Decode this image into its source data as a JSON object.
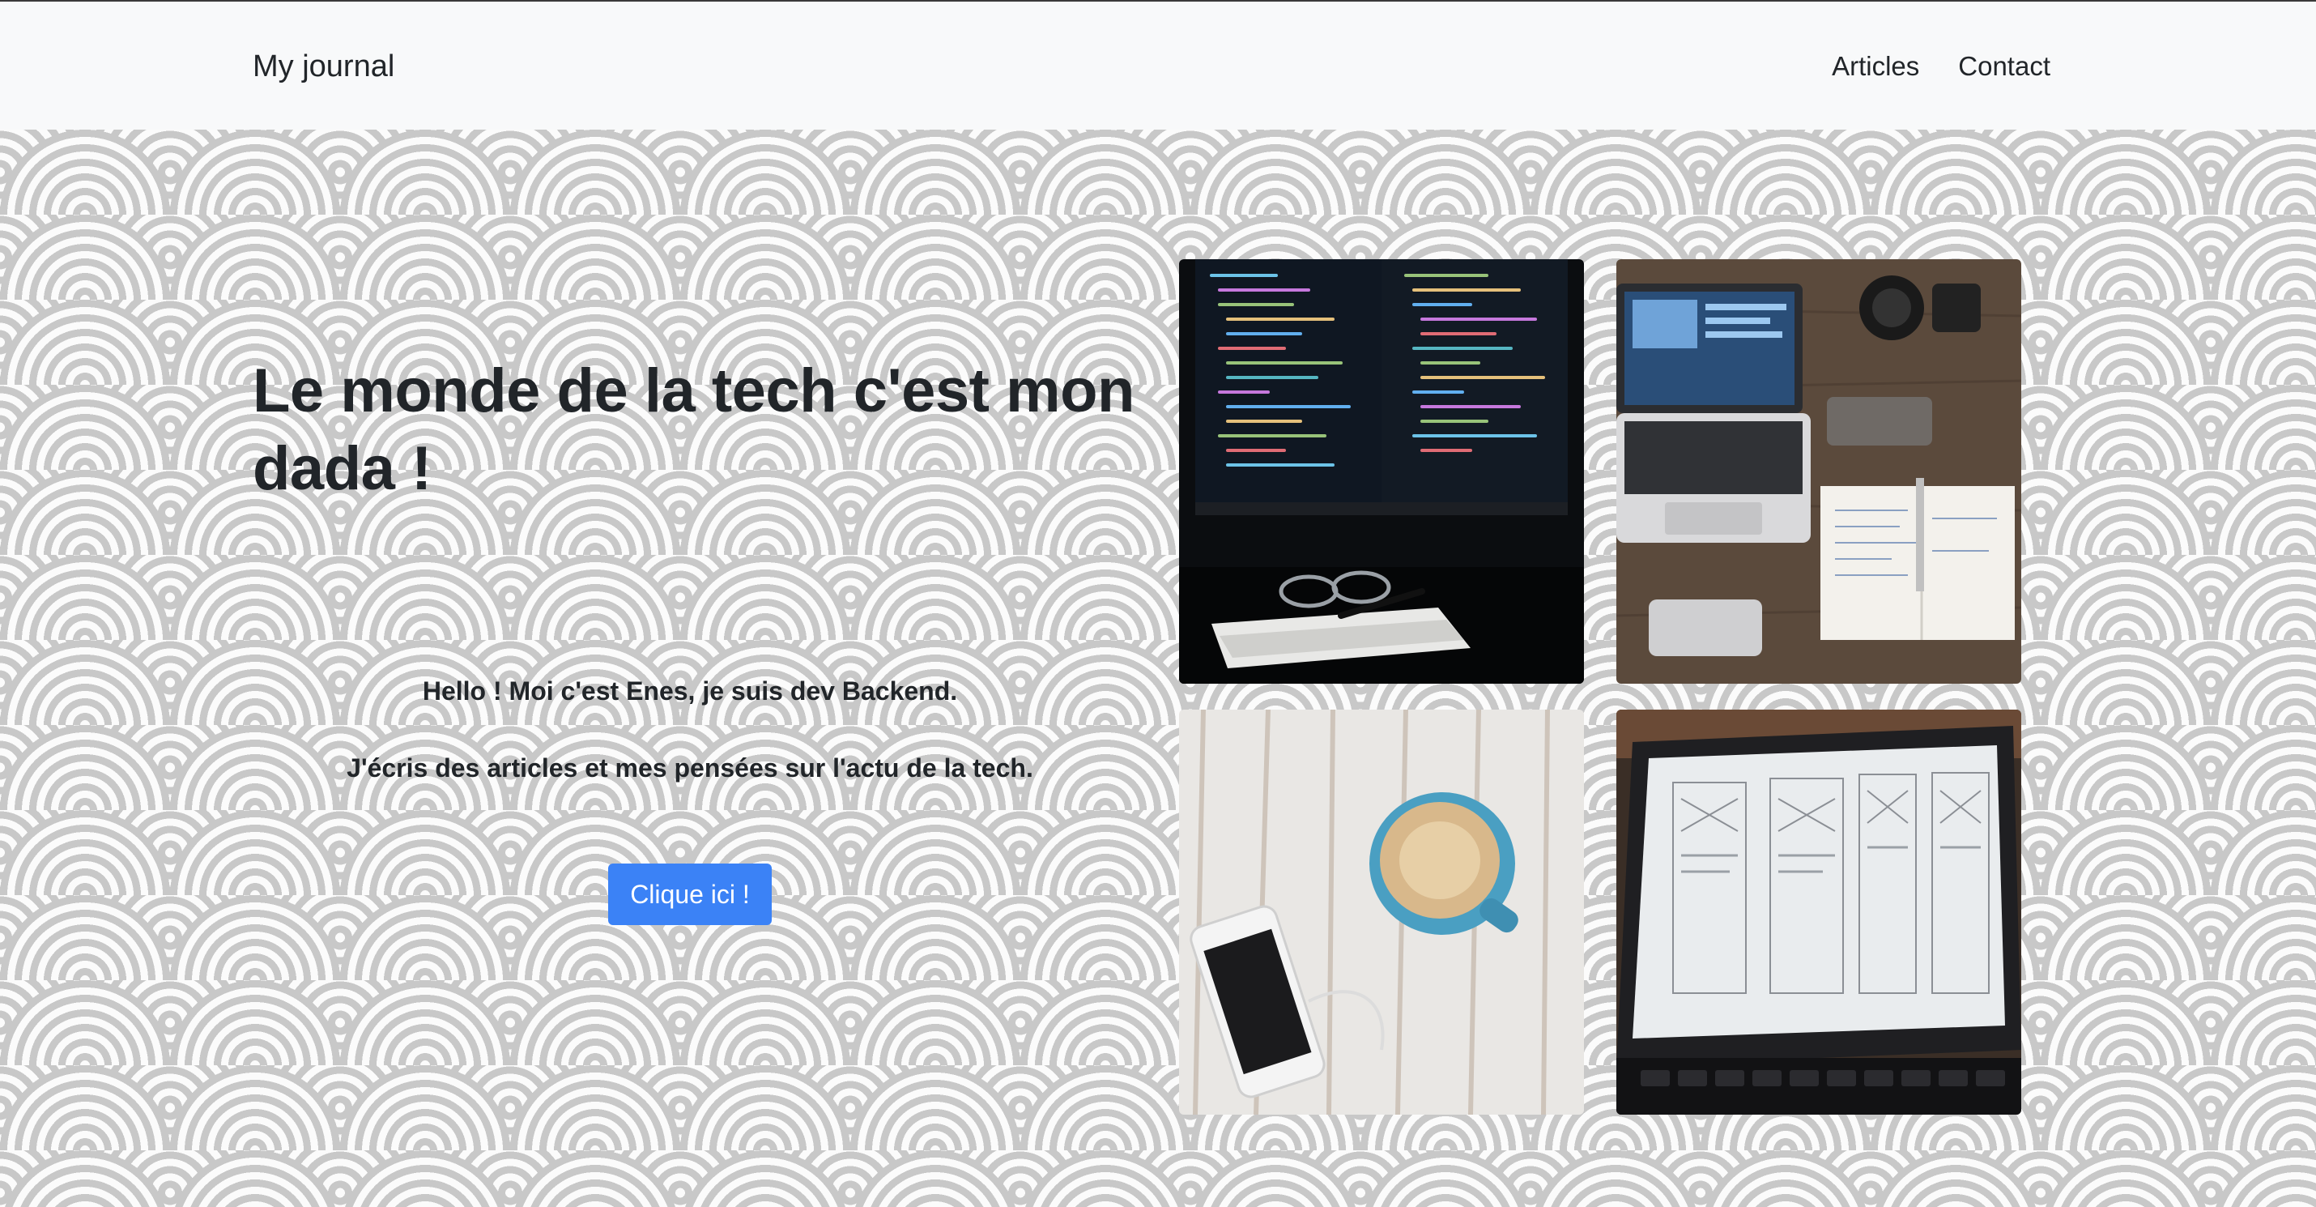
{
  "navbar": {
    "brand": "My journal",
    "links": [
      {
        "label": "Articles"
      },
      {
        "label": "Contact"
      }
    ]
  },
  "hero": {
    "headline": "Le monde de la tech c'est mon dada !",
    "intro_line_1": "Hello ! Moi c'est Enes, je suis dev Backend.",
    "intro_line_2": "J'écris des articles et mes pensées sur l'actu de la tech.",
    "cta_label": "Clique ici !"
  },
  "gallery": [
    {
      "subject": "code on monitor with glasses and notebook"
    },
    {
      "subject": "laptop, phone, camera lens and notebook on wooden desk"
    },
    {
      "subject": "smartphone and coffee cup on white wooden table"
    },
    {
      "subject": "laptop showing wireframe mockups"
    }
  ],
  "colors": {
    "accent": "#3b82f6",
    "navbar_bg": "#f8f9fa",
    "text": "#212529",
    "pattern_line": "#c8c8c8"
  }
}
